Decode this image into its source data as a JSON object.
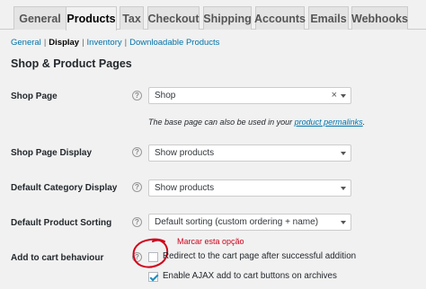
{
  "tabs": [
    {
      "label": "General"
    },
    {
      "label": "Products"
    },
    {
      "label": "Tax"
    },
    {
      "label": "Checkout"
    },
    {
      "label": "Shipping"
    },
    {
      "label": "Accounts"
    },
    {
      "label": "Emails"
    },
    {
      "label": "Webhooks"
    }
  ],
  "subnav": {
    "general": "General",
    "display": "Display",
    "inventory": "Inventory",
    "downloadable": "Downloadable Products",
    "separator": "|"
  },
  "section_title": "Shop & Product Pages",
  "help_glyph": "?",
  "shop_page": {
    "label": "Shop Page",
    "value": "Shop",
    "clear": "×",
    "desc_text": "The base page can also be used in your",
    "desc_link": "product permalinks",
    "desc_end": "."
  },
  "shop_page_display": {
    "label": "Shop Page Display",
    "value": "Show products"
  },
  "default_category_display": {
    "label": "Default Category Display",
    "value": "Show products"
  },
  "default_product_sorting": {
    "label": "Default Product Sorting",
    "value": "Default sorting (custom ordering + name)"
  },
  "add_to_cart": {
    "label": "Add to cart behaviour",
    "annotation": "Marcar esta opção",
    "annotation_color": "#d0021b",
    "redirect": {
      "label": "Redirect to the cart page after successful addition",
      "checked": false
    },
    "ajax": {
      "label": "Enable AJAX add to cart buttons on archives",
      "checked": true
    }
  }
}
